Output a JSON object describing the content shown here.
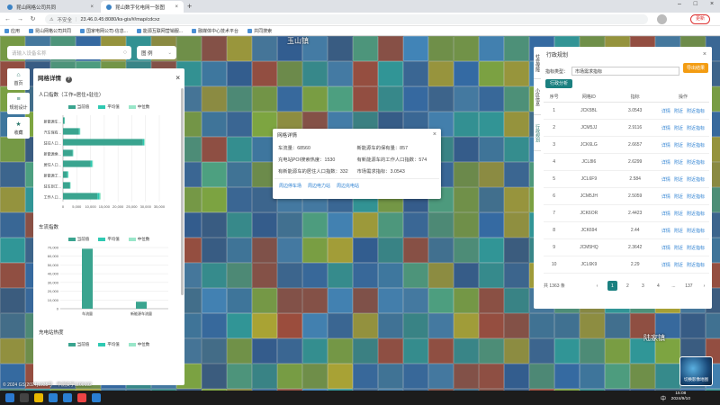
{
  "browser": {
    "tabs": [
      {
        "title": "昆山网格公司共同",
        "active": false
      },
      {
        "title": "昆山数字化电网一张图",
        "active": true
      }
    ],
    "new_tab": "+",
    "not_secure": "不安全",
    "url": "23.46.0.45:8080/ks-gis/#/map/cdcxz",
    "bookmarks": [
      "应用",
      "昆山网格公司共同",
      "国家电网公司-信息...",
      "能源互联网营销服...",
      "融媒体中心技术平台",
      "共同搜索"
    ],
    "update_label": "更新"
  },
  "map": {
    "place_labels": [
      "玉山镇",
      "陆家镇"
    ],
    "copyright": "© 2024 GS(2024)1935号 - 甲测资字1100192",
    "satellite_label": "切换影像地图"
  },
  "search": {
    "placeholder": "请输入设备名称",
    "layer_select": "图 例"
  },
  "rail": [
    {
      "icon": "home-icon",
      "label": "首页",
      "glyph": "⌂"
    },
    {
      "icon": "layer-icon",
      "label": "规划设计",
      "glyph": "≡"
    },
    {
      "icon": "star-icon",
      "label": "收藏",
      "glyph": "★"
    }
  ],
  "left_panel": {
    "title": "网格详情",
    "help": "?",
    "close": "×",
    "section1_title": "人口指数（工作+居住+驻往）",
    "section2_title": "车流指数",
    "section3_title": "充电站热度",
    "legend": [
      "当前值",
      "平均值",
      "中位数"
    ],
    "colors": {
      "current": "#3aa48f",
      "average": "#2fc9b2",
      "median": "#99e6c9"
    }
  },
  "chart_data": [
    {
      "type": "bar",
      "orientation": "horizontal",
      "title": "人口指数（工作+居住+驻往）",
      "categories": [
        "新能源车...",
        "汽车保有...",
        "驻往人口...",
        "新能源乘...",
        "居住人口...",
        "新能源工...",
        "驻车到工...",
        "工作人口..."
      ],
      "series": [
        {
          "name": "当前值",
          "values": [
            500,
            5800,
            29000,
            3500,
            10000,
            1500,
            2500,
            12500
          ]
        },
        {
          "name": "平均值",
          "values": [
            100,
            300,
            500,
            200,
            600,
            300,
            200,
            800
          ]
        },
        {
          "name": "中位数",
          "values": [
            100,
            200,
            300,
            100,
            300,
            200,
            100,
            400
          ]
        }
      ],
      "x_ticks": [
        "0",
        "5,000",
        "10,000",
        "15,000",
        "20,000",
        "25,000",
        "30,000",
        "35,000"
      ],
      "xlim": [
        0,
        35000
      ]
    },
    {
      "type": "bar",
      "title": "车流指数",
      "categories": [
        "车流量",
        "新能源车流量"
      ],
      "series": [
        {
          "name": "当前值",
          "values": [
            68560,
            8000
          ]
        },
        {
          "name": "平均值",
          "values": [
            0,
            0
          ]
        },
        {
          "name": "中位数",
          "values": [
            0,
            0
          ]
        }
      ],
      "y_ticks": [
        "0",
        "10,000",
        "20,000",
        "30,000",
        "40,000",
        "50,000",
        "60,000",
        "70,000"
      ],
      "ylim": [
        0,
        70000
      ]
    }
  ],
  "popup": {
    "title": "网格详情",
    "close": "×",
    "fields": [
      "车流量：68560",
      "新能源车的保有量：857",
      "充电站POI搜索热度：1530",
      "有新能源车的工作人口指数：574",
      "有新能源车的居住人口指数：332",
      "市场需求指标：3.0543"
    ],
    "links": [
      "周边停车场",
      "周边电力站",
      "周边充电站"
    ]
  },
  "right_panel": {
    "side_tabs": [
      "社会保障",
      "小区信息",
      "行政规划"
    ],
    "title": "行政规划",
    "close": "×",
    "filter_label": "指标类型：",
    "filter_value": "市场需求指标",
    "export_button": "导出结果",
    "analyze_button": "行政分析",
    "columns": [
      "序号",
      "网格ID",
      "指标",
      "操作"
    ],
    "rows": [
      [
        "1",
        "JCK5BL",
        "3.0543"
      ],
      [
        "2",
        "JCM5JJ",
        "2.9116"
      ],
      [
        "3",
        "JCK6LG",
        "2.6657"
      ],
      [
        "4",
        "JCL8I6",
        "2.6299"
      ],
      [
        "5",
        "JCL6F9",
        "2.584"
      ],
      [
        "6",
        "JCM5JH",
        "2.5059"
      ],
      [
        "7",
        "JCK6OR",
        "2.4423"
      ],
      [
        "8",
        "JCK694",
        "2.44"
      ],
      [
        "9",
        "JCM5HQ",
        "2.3642"
      ],
      [
        "10",
        "JCL6K9",
        "2.29"
      ]
    ],
    "actions": [
      "详情",
      "附近",
      "附近指标"
    ],
    "total": "共 1363 条",
    "pages": [
      "1",
      "2",
      "3",
      "4",
      "...",
      "137"
    ],
    "prev": "‹",
    "next": "›"
  },
  "taskbar": {
    "time": "15:08",
    "date": "2024/9/10",
    "ime": "中"
  }
}
